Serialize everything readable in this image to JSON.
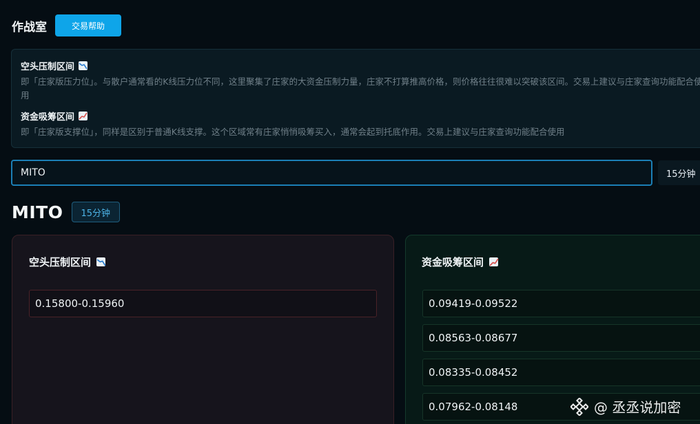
{
  "header": {
    "title": "作战室",
    "help_button": "交易帮助"
  },
  "info": {
    "short_zone": {
      "title": "空头压制区间",
      "icon": "chart-decreasing-icon",
      "desc": "即「庄家版压力位」。与散户通常看的K线压力位不同，这里聚集了庄家的大资金压制力量，庄家不打算推高价格，则价格往往很难以突破该区间。交易上建议与庄家查询功能配合使用"
    },
    "accum_zone": {
      "title": "资金吸筹区间",
      "icon": "chart-increasing-icon",
      "desc": "即「庄家版支撑位」，同样是区别于普通K线支撑。这个区域常有庄家悄悄吸筹买入，通常会起到托底作用。交易上建议与庄家查询功能配合使用"
    }
  },
  "search": {
    "value": "MITO",
    "timeframe": "15分钟"
  },
  "result": {
    "symbol": "MITO",
    "timeframe_badge": "15分钟",
    "short_card": {
      "title": "空头压制区间",
      "ranges": [
        "0.15800-0.15960"
      ]
    },
    "accum_card": {
      "title": "资金吸筹区间",
      "ranges": [
        "0.09419-0.09522",
        "0.08563-0.08677",
        "0.08335-0.08452",
        "0.07962-0.08148"
      ]
    }
  },
  "watermark": {
    "text": "@ 丞丞说加密",
    "icon": "binance-logo-icon"
  },
  "colors": {
    "accent": "#0ea5e9",
    "short_border": "#3a2026",
    "accum_border": "#143a2c",
    "background": "#050d13"
  }
}
